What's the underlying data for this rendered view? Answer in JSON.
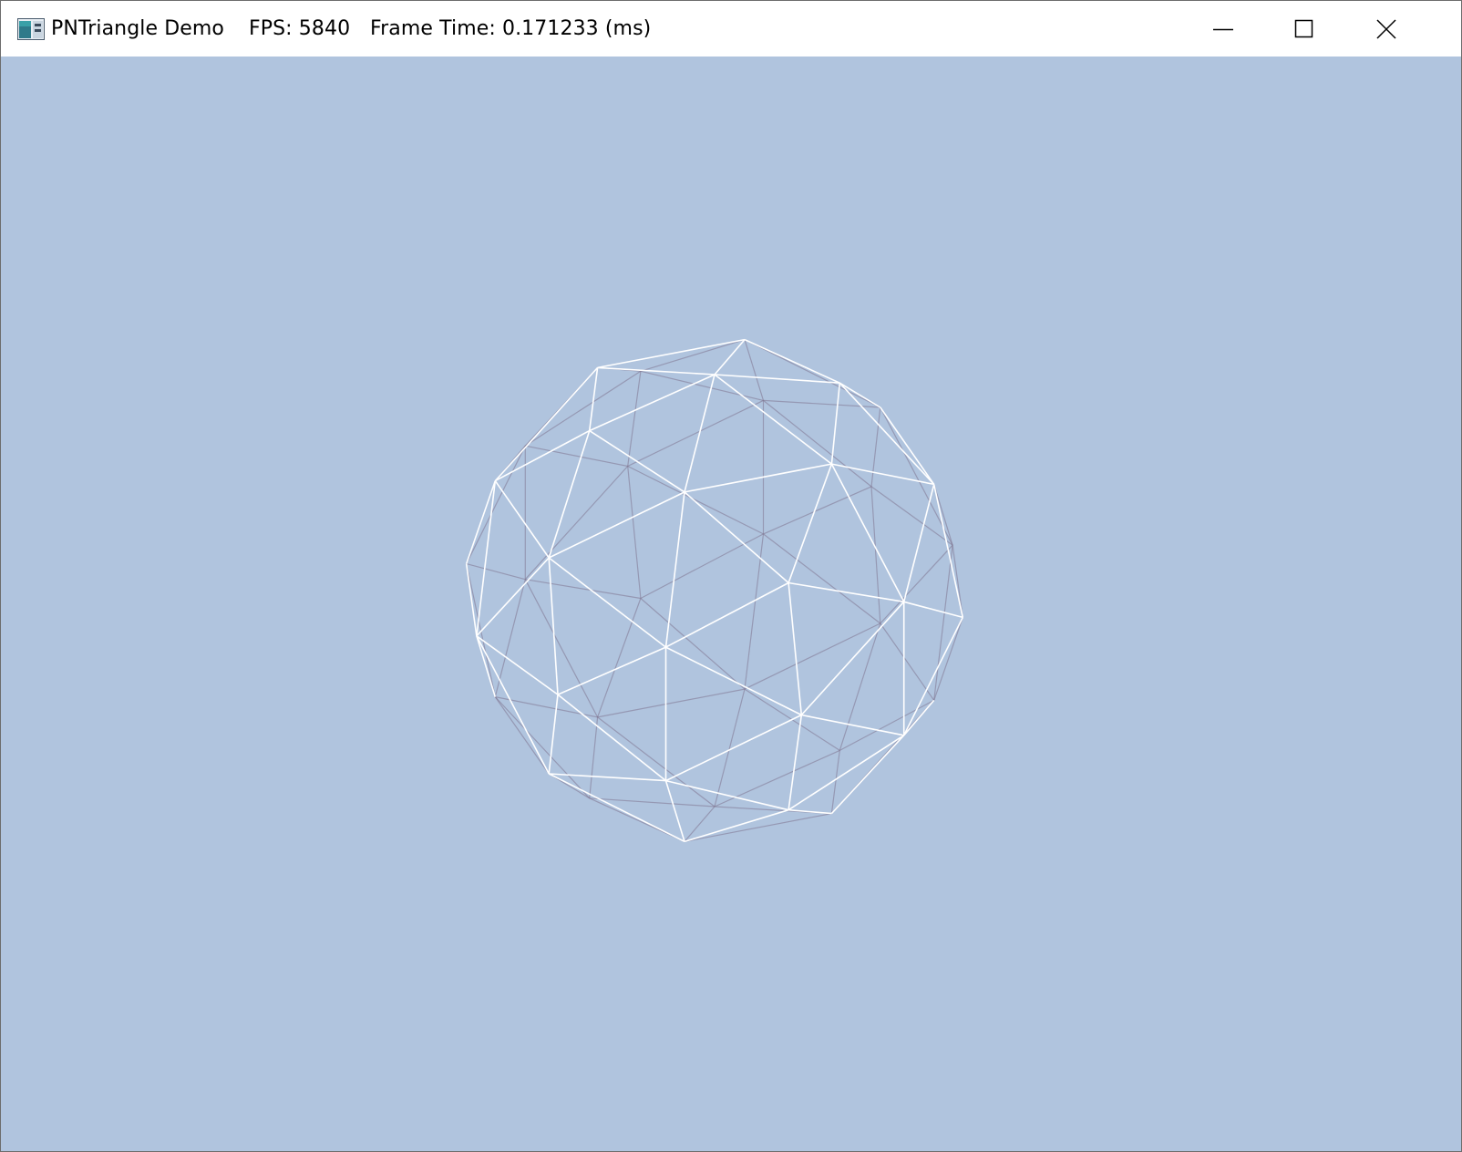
{
  "window": {
    "app_name": "PNTriangle Demo",
    "fps_text": "FPS: 5840",
    "frame_time_text": "Frame Time: 0.171233 (ms)",
    "icon": "application-icon",
    "controls": {
      "minimize_icon": "minimize-icon",
      "maximize_icon": "maximize-icon",
      "close_icon": "close-icon"
    }
  },
  "viewport": {
    "background_color": "#b0c4de",
    "content": "wireframe-sphere",
    "front_line_color": "#ffffff",
    "back_line_color": "#7f748f"
  }
}
